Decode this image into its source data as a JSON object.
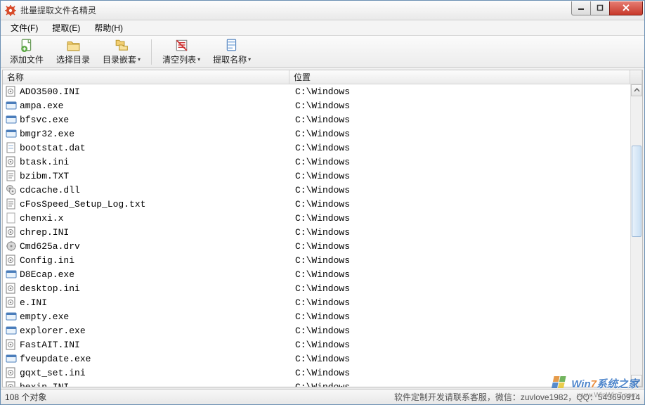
{
  "window": {
    "title": "批量提取文件名精灵"
  },
  "menu": {
    "items": [
      {
        "label": "文件(F)"
      },
      {
        "label": "提取(E)"
      },
      {
        "label": "帮助(H)"
      }
    ]
  },
  "toolbar": {
    "items": [
      {
        "label": "添加文件",
        "icon": "add-file",
        "dropdown": false
      },
      {
        "label": "选择目录",
        "icon": "folder",
        "dropdown": false
      },
      {
        "label": "目录嵌套",
        "icon": "nested",
        "dropdown": true
      },
      {
        "label": "清空列表",
        "icon": "clear",
        "dropdown": true
      },
      {
        "label": "提取名称",
        "icon": "extract",
        "dropdown": true
      }
    ]
  },
  "columns": {
    "name": "名称",
    "location": "位置"
  },
  "files": [
    {
      "name": "ADO3500.INI",
      "location": "C:\\Windows",
      "type": "ini"
    },
    {
      "name": "ampa.exe",
      "location": "C:\\Windows",
      "type": "exe"
    },
    {
      "name": "bfsvc.exe",
      "location": "C:\\Windows",
      "type": "exe"
    },
    {
      "name": "bmgr32.exe",
      "location": "C:\\Windows",
      "type": "exe"
    },
    {
      "name": "bootstat.dat",
      "location": "C:\\Windows",
      "type": "dat"
    },
    {
      "name": "btask.ini",
      "location": "C:\\Windows",
      "type": "ini"
    },
    {
      "name": "bzibm.TXT",
      "location": "C:\\Windows",
      "type": "txt"
    },
    {
      "name": "cdcache.dll",
      "location": "C:\\Windows",
      "type": "dll"
    },
    {
      "name": "cFosSpeed_Setup_Log.txt",
      "location": "C:\\Windows",
      "type": "txt"
    },
    {
      "name": "chenxi.x",
      "location": "C:\\Windows",
      "type": "other"
    },
    {
      "name": "chrep.INI",
      "location": "C:\\Windows",
      "type": "ini"
    },
    {
      "name": "Cmd625a.drv",
      "location": "C:\\Windows",
      "type": "drv"
    },
    {
      "name": "Config.ini",
      "location": "C:\\Windows",
      "type": "ini"
    },
    {
      "name": "D8Ecap.exe",
      "location": "C:\\Windows",
      "type": "exe"
    },
    {
      "name": "desktop.ini",
      "location": "C:\\Windows",
      "type": "ini"
    },
    {
      "name": "e.INI",
      "location": "C:\\Windows",
      "type": "ini"
    },
    {
      "name": "empty.exe",
      "location": "C:\\Windows",
      "type": "exe"
    },
    {
      "name": "explorer.exe",
      "location": "C:\\Windows",
      "type": "exe"
    },
    {
      "name": "FastAIT.INI",
      "location": "C:\\Windows",
      "type": "ini"
    },
    {
      "name": "fveupdate.exe",
      "location": "C:\\Windows",
      "type": "exe"
    },
    {
      "name": "gqxt_set.ini",
      "location": "C:\\Windows",
      "type": "ini"
    },
    {
      "name": "hexin.INI",
      "location": "C:\\Windows",
      "type": "ini"
    }
  ],
  "status": {
    "count_label": "108 个对象",
    "right_text": "软件定制开发请联系客服，微信：zuvlove1982，QQ：543690914"
  },
  "watermark": {
    "brand_prefix": "Win",
    "brand_digit": "7",
    "brand_suffix": "系统之家",
    "url": "www.WinWin7.com"
  }
}
